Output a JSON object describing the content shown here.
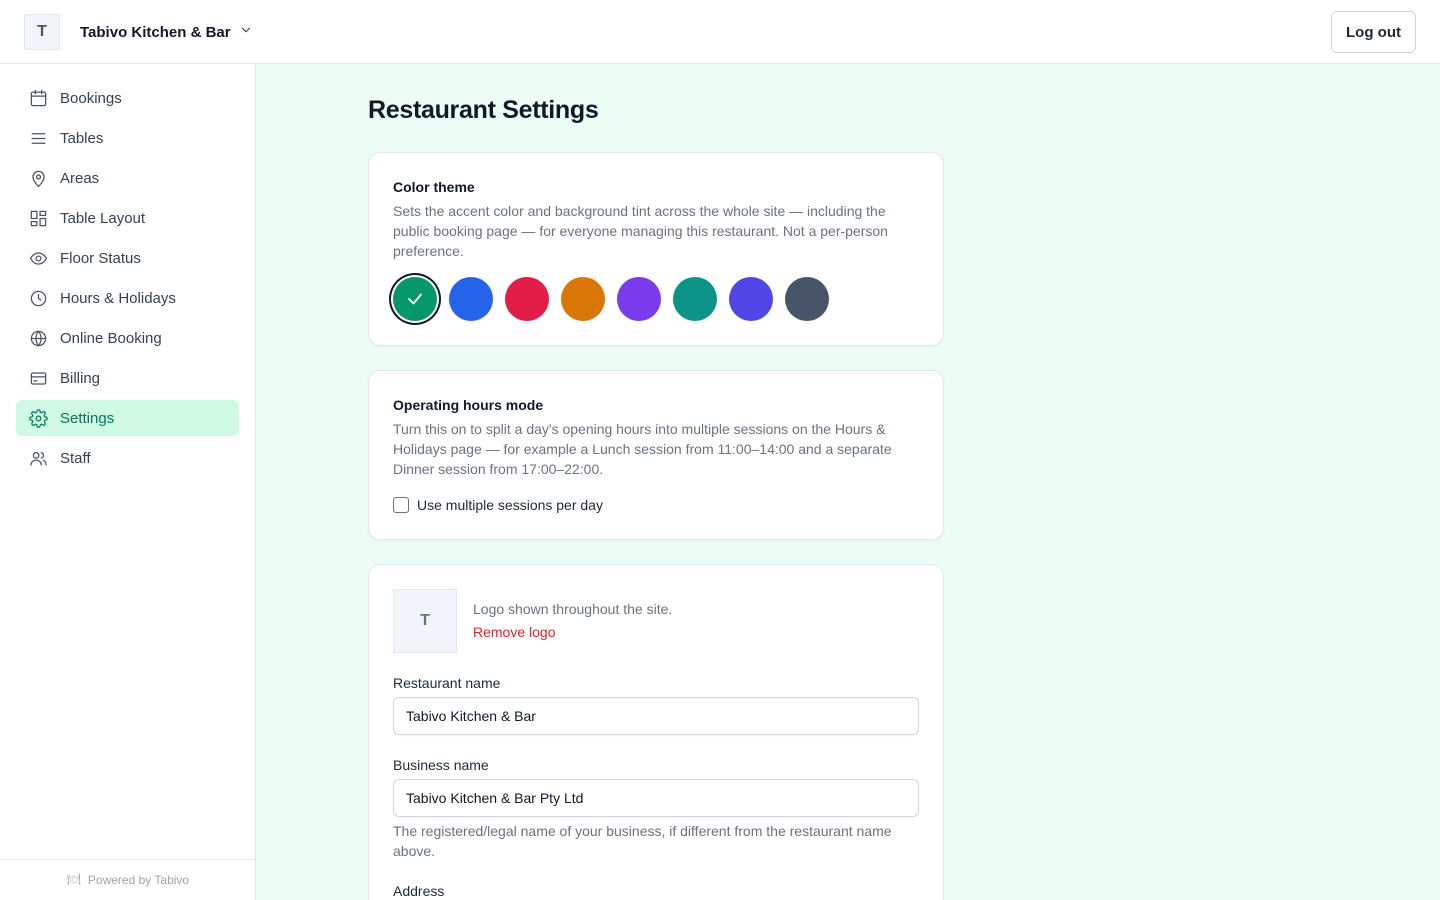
{
  "header": {
    "logo_letter": "T",
    "restaurant_name": "Tabivo Kitchen & Bar",
    "logout_label": "Log out"
  },
  "sidebar": {
    "items": [
      {
        "label": "Bookings",
        "icon": "calendar-icon"
      },
      {
        "label": "Tables",
        "icon": "list-icon"
      },
      {
        "label": "Areas",
        "icon": "map-pin-icon"
      },
      {
        "label": "Table Layout",
        "icon": "layout-grid-icon"
      },
      {
        "label": "Floor Status",
        "icon": "eye-icon"
      },
      {
        "label": "Hours & Holidays",
        "icon": "clock-icon"
      },
      {
        "label": "Online Booking",
        "icon": "globe-icon"
      },
      {
        "label": "Billing",
        "icon": "credit-card-icon"
      },
      {
        "label": "Settings",
        "icon": "gear-icon",
        "active": true
      },
      {
        "label": "Staff",
        "icon": "users-icon"
      }
    ],
    "powered_by": "Powered by Tabivo"
  },
  "main": {
    "title": "Restaurant Settings",
    "color_theme": {
      "heading": "Color theme",
      "description": "Sets the accent color and background tint across the whole site — including the public booking page — for everyone managing this restaurant. Not a per-person preference.",
      "swatches": [
        "#059669",
        "#2563eb",
        "#e11d48",
        "#d97706",
        "#7c3aed",
        "#0d9488",
        "#4f46e5",
        "#475569"
      ],
      "selected": "#059669"
    },
    "operating_hours": {
      "heading": "Operating hours mode",
      "description": "Turn this on to split a day's opening hours into multiple sessions on the Hours & Holidays page — for example a Lunch session from 11:00–14:00 and a separate Dinner session from 17:00–22:00.",
      "checkbox_label": "Use multiple sessions per day",
      "checked": false
    },
    "profile": {
      "logo_letter": "T",
      "logo_text": "Logo shown throughout the site.",
      "remove_logo": "Remove logo",
      "restaurant_name_label": "Restaurant name",
      "restaurant_name_value": "Tabivo Kitchen & Bar",
      "business_name_label": "Business name",
      "business_name_value": "Tabivo Kitchen & Bar Pty Ltd",
      "business_name_help": "The registered/legal name of your business, if different from the restaurant name above.",
      "address_label": "Address"
    }
  }
}
